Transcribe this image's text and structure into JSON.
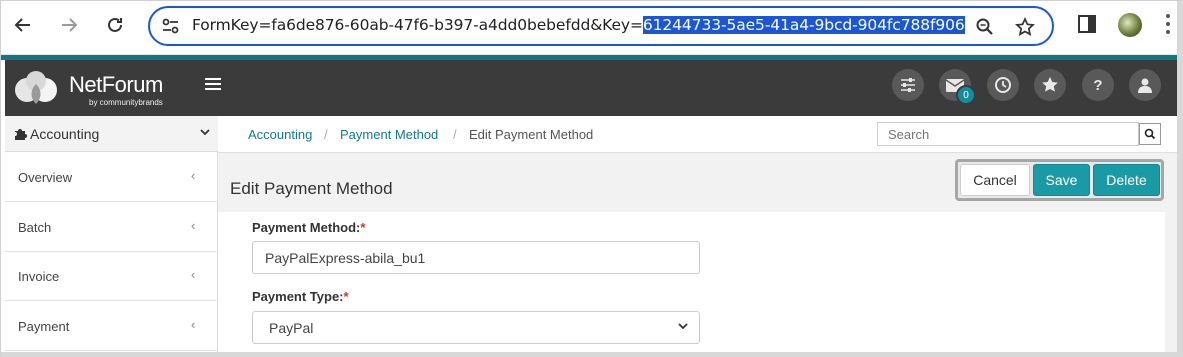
{
  "browser": {
    "url_prefix": "FormKey=fa6de876-60ab-47f6-b397-a4dd0bebefdd&Key=",
    "url_selected": "61244733-5ae5-41a4-9bcd-904fc788f906"
  },
  "header": {
    "logo_text": "NetForum",
    "logo_sub": "by communitybrands",
    "mail_badge": "0",
    "icons": [
      "sliders-icon",
      "mail-icon",
      "history-icon",
      "star-icon",
      "help-icon",
      "user-icon"
    ]
  },
  "sidebar": {
    "module": "Accounting",
    "items": [
      {
        "label": "Overview"
      },
      {
        "label": "Batch"
      },
      {
        "label": "Invoice"
      },
      {
        "label": "Payment"
      }
    ]
  },
  "breadcrumb": {
    "items": [
      "Accounting",
      "Payment Method",
      "Edit Payment Method"
    ],
    "separator": "/"
  },
  "search": {
    "placeholder": "Search"
  },
  "page": {
    "title": "Edit Payment Method"
  },
  "actions": {
    "cancel": "Cancel",
    "save": "Save",
    "delete": "Delete"
  },
  "form": {
    "payment_method": {
      "label": "Payment Method:",
      "required": "*",
      "value": "PayPalExpress-abila_bu1"
    },
    "payment_type": {
      "label": "Payment Type:",
      "required": "*",
      "value": "PayPal"
    }
  },
  "colors": {
    "accent": "#1a9aa5",
    "header_bg": "#3b3b3b",
    "link": "#147b84",
    "required": "#d9302b"
  }
}
